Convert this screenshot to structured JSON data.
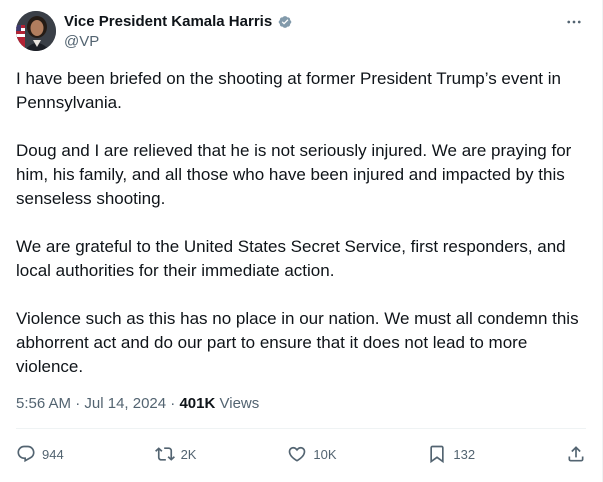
{
  "author": {
    "name": "Vice President Kamala Harris",
    "handle": "@VP",
    "verified_color": "#829aab"
  },
  "post": {
    "paragraphs": [
      "I have been briefed on the shooting at former President Trump’s event in Pennsylvania.",
      "Doug and I are relieved that he is not seriously injured. We are praying for him, his family, and all those who have been injured and impacted by this senseless shooting.",
      "We are grateful to the United States Secret Service, first responders, and local authorities for their immediate action.",
      "Violence such as this has no place in our nation. We must all condemn this abhorrent act and do our part to ensure that it does not lead to more violence."
    ],
    "time": "5:56 AM",
    "date": "Jul 14, 2024",
    "separator": "·",
    "views_count": "401K",
    "views_label": "Views"
  },
  "actions": {
    "replies": "944",
    "reposts": "2K",
    "likes": "10K",
    "bookmarks": "132"
  },
  "icons": {
    "more": "more-icon",
    "reply": "reply-icon",
    "repost": "repost-icon",
    "like": "like-icon",
    "bookmark": "bookmark-icon",
    "share": "share-icon"
  }
}
